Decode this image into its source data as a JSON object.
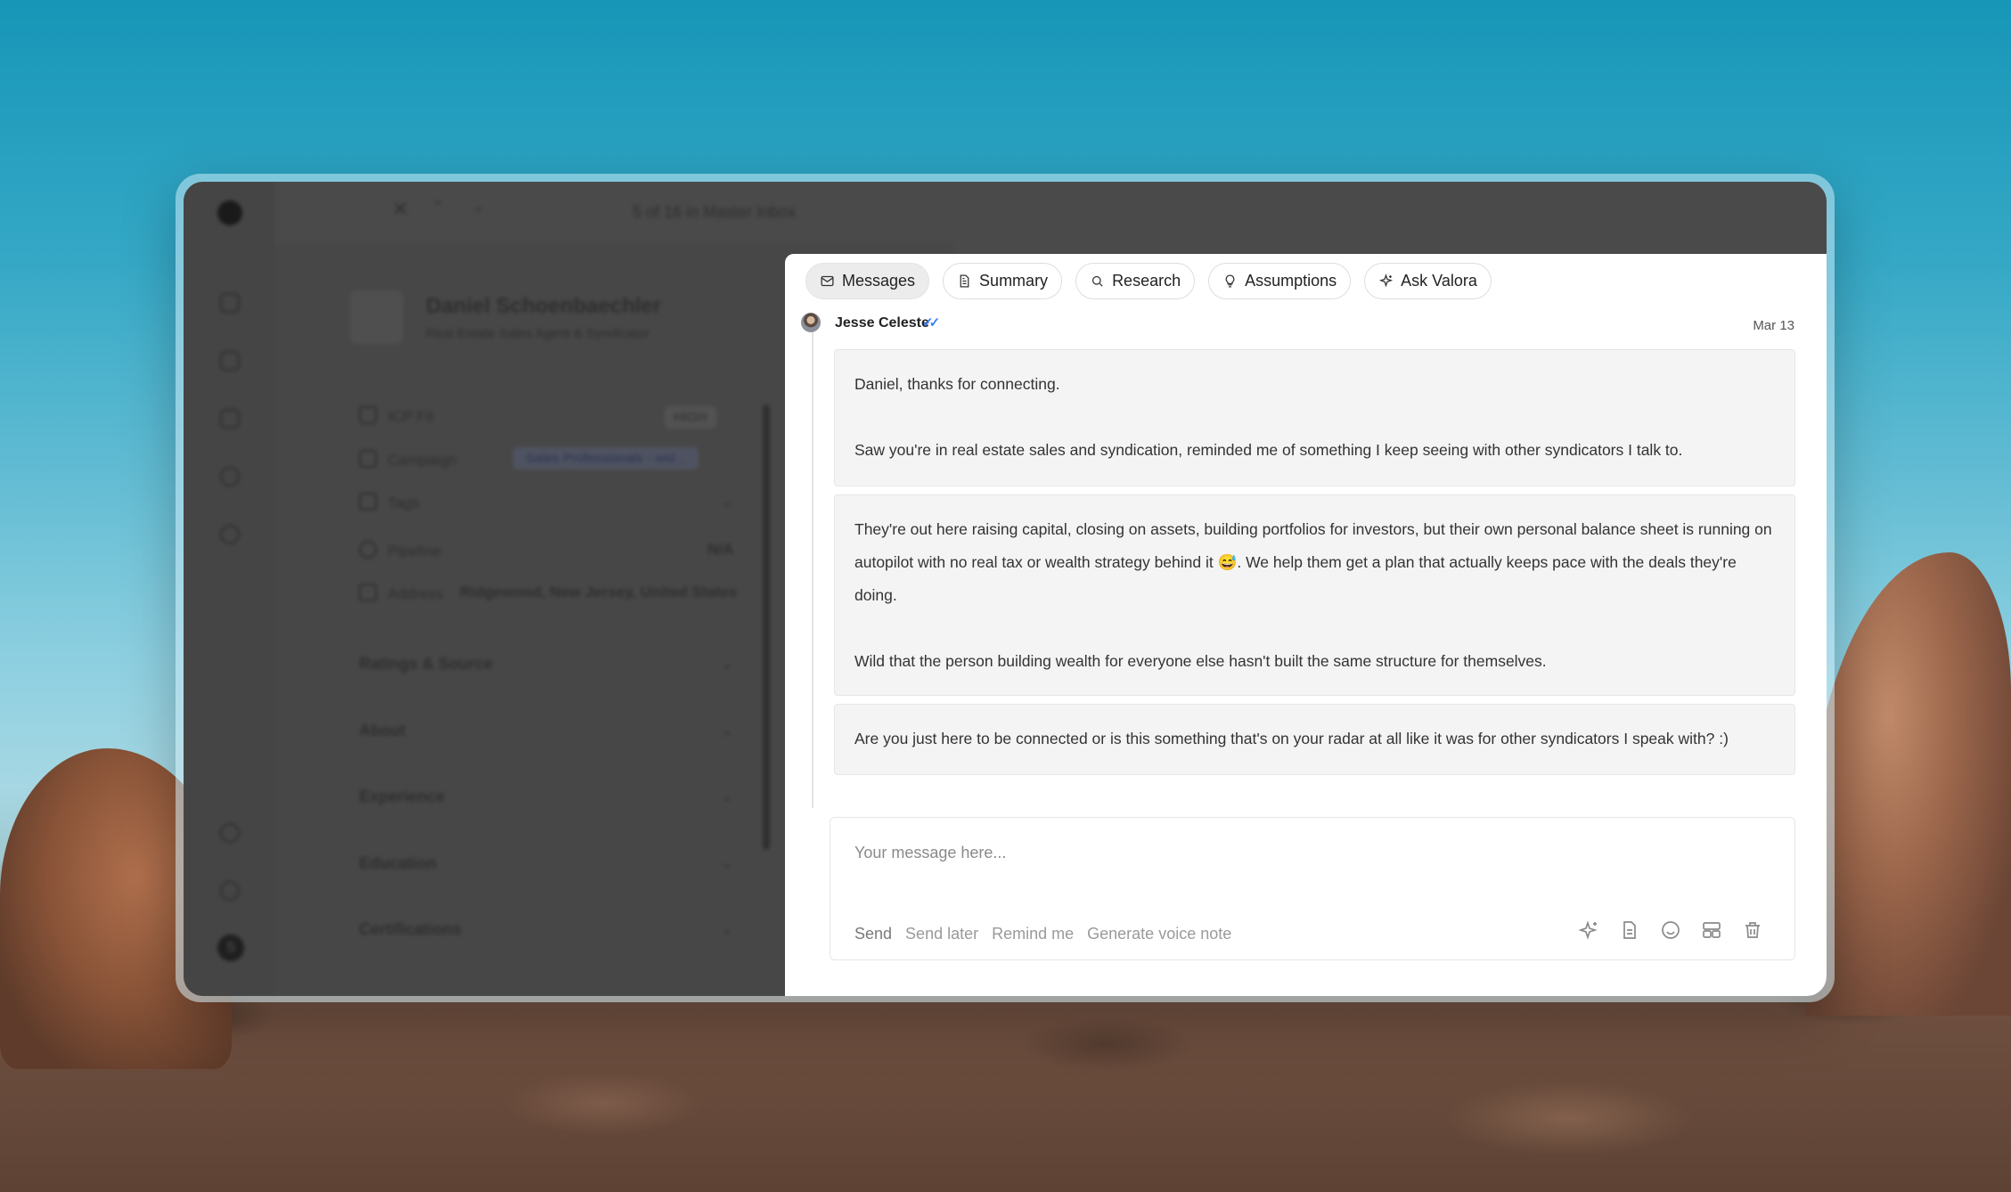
{
  "background_app": {
    "nav_counter": "5 of 16 in Master Inbox",
    "contact": {
      "name": "Daniel Schoenbaechler",
      "headline": "Real Estate Sales Agent & Syndicator"
    },
    "fields": [
      {
        "label": "ICP Fit",
        "value": "HIGH"
      },
      {
        "label": "Campaign",
        "value": "Sales Professionals - wid..."
      },
      {
        "label": "Tags",
        "value": ""
      },
      {
        "label": "Pipeline",
        "value": "N/A"
      },
      {
        "label": "Address",
        "value": "Ridgewood, New Jersey, United States"
      }
    ],
    "sections": [
      "Ratings & Source",
      "About",
      "Experience",
      "Education",
      "Certifications"
    ],
    "user_initial": "S"
  },
  "tabs": [
    {
      "label": "Messages",
      "icon": "mail-icon",
      "active": true
    },
    {
      "label": "Summary",
      "icon": "document-icon",
      "active": false
    },
    {
      "label": "Research",
      "icon": "search-icon",
      "active": false
    },
    {
      "label": "Assumptions",
      "icon": "lightbulb-icon",
      "active": false
    },
    {
      "label": "Ask Valora",
      "icon": "sparkle-icon",
      "active": false
    }
  ],
  "thread": {
    "sender": "Jesse Celeste",
    "date": "Mar 13",
    "messages": [
      {
        "paragraphs": [
          "Daniel, thanks for connecting.",
          "Saw you're in real estate sales and syndication, reminded me of something I keep seeing with other syndicators I talk to."
        ]
      },
      {
        "paragraphs": [
          "They're out here raising capital, closing on assets, building portfolios for investors, but their own personal balance sheet is running on autopilot with no real tax or wealth strategy behind it 😅. We help them get a plan that actually keeps pace with the deals they're doing.",
          "Wild that the person building wealth for everyone else hasn't built the same structure for themselves."
        ]
      },
      {
        "paragraphs": [
          "Are you just here to be connected or is this something that's on your radar at all like it was for other syndicators I speak with? :)"
        ]
      }
    ]
  },
  "composer": {
    "placeholder": "Your message here...",
    "value": "",
    "actions": [
      "Send",
      "Send later",
      "Remind me",
      "Generate voice note"
    ],
    "icons": [
      "ai-sparkle-icon",
      "template-icon",
      "emoji-icon",
      "layout-icon",
      "trash-icon"
    ]
  }
}
